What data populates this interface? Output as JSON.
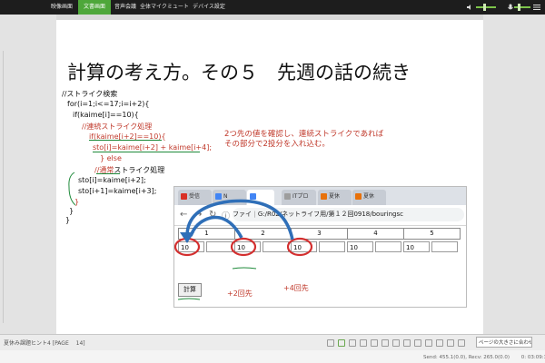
{
  "topbar": {
    "tabs": [
      "映像画面",
      "文書画面",
      "音声会議",
      "全体マイクミュート",
      "デバイス設定"
    ],
    "active_tab": 1,
    "accent_color": "#4ea73a"
  },
  "slide": {
    "title": "計算の考え方。その５　先週の話の続き",
    "code": {
      "comment1": "//ストライク検索",
      "for_line": "for(i=1;i<=17;i=i+2){",
      "if_line": "if(kaime[i]==10){",
      "comment2": "//連続ストライク処理",
      "if2_line": "if(kaime[i+2]==10){",
      "sto_red_line": "sto[i]=kaime[i+2] + kaime[i+4];",
      "else_line": "} else",
      "comment3_a": "//通常",
      "comment3_b": "ストライク処理",
      "sto1_line": "sto[i]=kaime[i+2];",
      "sto2_line": "sto[i+1]=kaime[i+3];",
      "brace1": "}",
      "brace2": "}",
      "brace3": "}"
    },
    "note_line1": "2つ先の値を確認し、連続ストライクであれば",
    "note_line2": "その部分で2投分を入れ込む。"
  },
  "browser": {
    "tabs": [
      "受信",
      "N",
      "",
      "ITプロ",
      "夏休",
      "夏休"
    ],
    "url_prefix": "ファイ",
    "url": "G:/R02/ネットライフ用/第１２回0918/bouringsc",
    "headers": [
      "1",
      "2",
      "3",
      "4",
      "5"
    ],
    "inputs": [
      "10",
      "",
      "10",
      "",
      "10",
      "",
      "10",
      "",
      "10",
      ""
    ],
    "calc_button": "計算",
    "label_plus2": "+2回先",
    "label_plus4": "+4回先"
  },
  "status": {
    "page_info": "夏休み課題ヒント4 [PAGE 　14]",
    "zoom_select": "ページの大きさに合わせる"
  },
  "network": {
    "info": "Send: 455.1(0.0), Recv: 265.0(0.0)　　 0: 03:09:33"
  }
}
